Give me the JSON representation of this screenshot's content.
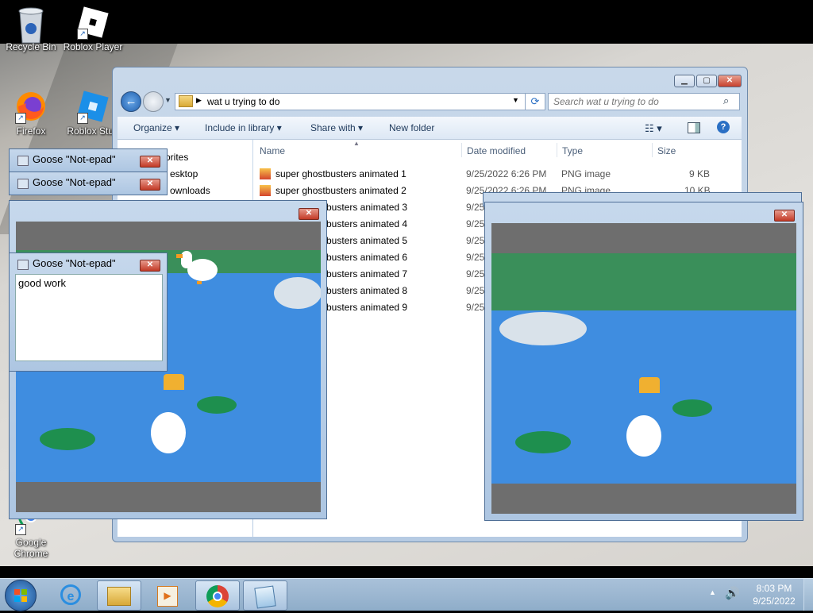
{
  "desktop": {
    "icons": [
      {
        "label": "Recycle Bin",
        "icon": "recycle-bin-icon"
      },
      {
        "label": "Roblox Player",
        "icon": "roblox-icon"
      },
      {
        "label": "Firefox",
        "icon": "firefox-icon"
      },
      {
        "label": "Roblox Stud",
        "icon": "roblox-studio-icon"
      },
      {
        "label": "Google",
        "label2": "Chrome",
        "icon": "chrome-icon"
      }
    ]
  },
  "explorer": {
    "address_path": "wat u trying to do",
    "search_placeholder": "Search wat u trying to do",
    "commands": {
      "organize": "Organize",
      "include": "Include in library",
      "share": "Share with",
      "new_folder": "New folder"
    },
    "nav_items": [
      "orites",
      "esktop",
      "ownloads"
    ],
    "columns": {
      "name": "Name",
      "date": "Date modified",
      "type": "Type",
      "size": "Size"
    },
    "files": [
      {
        "name": "super ghostbusters animated 1",
        "date": "9/25/2022 6:26 PM",
        "type": "PNG image",
        "size": "9 KB"
      },
      {
        "name": "super ghostbusters animated 2",
        "date": "9/25/2022 6:26 PM",
        "type": "PNG image",
        "size": "10 KB"
      },
      {
        "name": "busters animated 3",
        "date": "9/25",
        "type": "",
        "size": ""
      },
      {
        "name": "busters animated 4",
        "date": "9/25",
        "type": "",
        "size": ""
      },
      {
        "name": "busters animated 5",
        "date": "9/25",
        "type": "",
        "size": ""
      },
      {
        "name": "busters animated 6",
        "date": "9/25",
        "type": "",
        "size": ""
      },
      {
        "name": "busters animated 7",
        "date": "9/25",
        "type": "",
        "size": ""
      },
      {
        "name": "busters animated 8",
        "date": "9/25",
        "type": "",
        "size": ""
      },
      {
        "name": "busters animated 9",
        "date": "9/25",
        "type": "",
        "size": ""
      }
    ]
  },
  "goose_notepads": {
    "title": "Goose \"Not-epad\"",
    "front_text": "good work"
  },
  "taskbar": {
    "time": "8:03 PM",
    "date": "9/25/2022"
  },
  "colors": {
    "pond": "#3f8de0",
    "grass": "#3a8f5a",
    "close": "#c33a26"
  }
}
